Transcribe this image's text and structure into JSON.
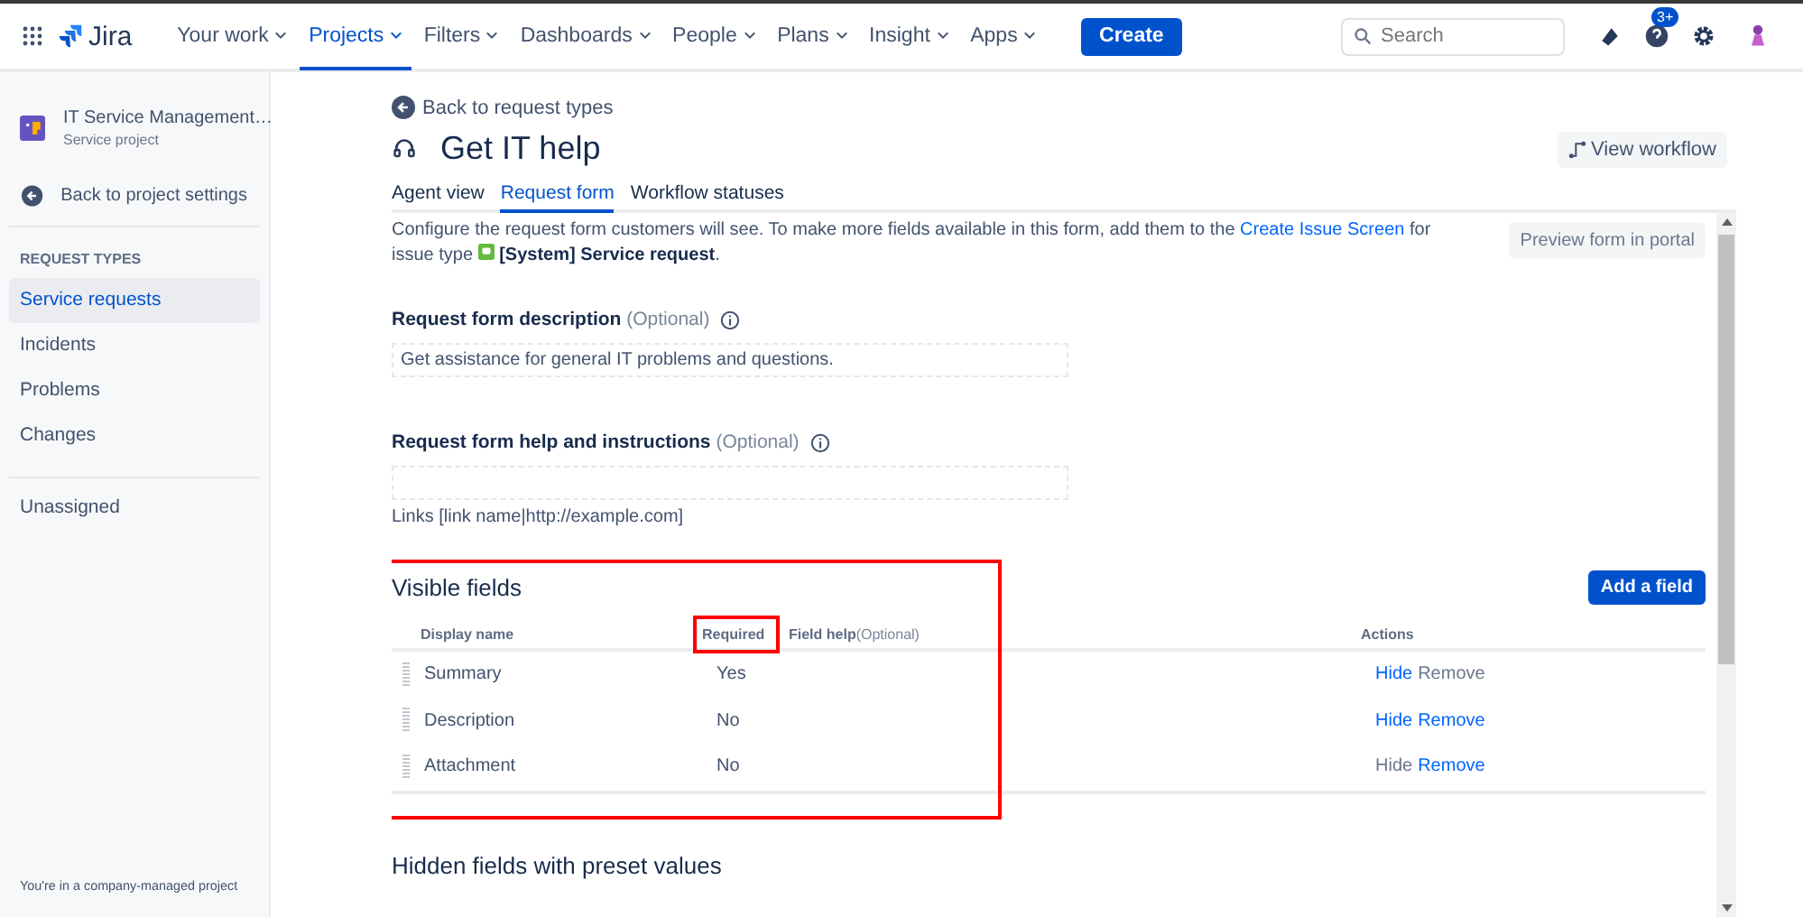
{
  "topnav": {
    "product": "Jira",
    "menus": [
      {
        "label": "Your work",
        "selected": false
      },
      {
        "label": "Projects",
        "selected": true
      },
      {
        "label": "Filters",
        "selected": false
      },
      {
        "label": "Dashboards",
        "selected": false
      },
      {
        "label": "People",
        "selected": false
      },
      {
        "label": "Plans",
        "selected": false
      },
      {
        "label": "Insight",
        "selected": false
      },
      {
        "label": "Apps",
        "selected": false
      }
    ],
    "create": "Create",
    "search": {
      "placeholder": "Search"
    },
    "help_badge": "3+"
  },
  "sidebar": {
    "project_name": "IT Service Management…",
    "project_type": "Service project",
    "back": "Back to project settings",
    "section": "REQUEST TYPES",
    "items": [
      {
        "label": "Service requests",
        "selected": true
      },
      {
        "label": "Incidents",
        "selected": false
      },
      {
        "label": "Problems",
        "selected": false
      },
      {
        "label": "Changes",
        "selected": false
      }
    ],
    "unassigned": "Unassigned",
    "footer": "You're in a company-managed project"
  },
  "header": {
    "back": "Back to request types",
    "title": "Get IT help",
    "view_workflow": "View workflow",
    "tabs": [
      {
        "label": "Agent view",
        "selected": false
      },
      {
        "label": "Request form",
        "selected": true
      },
      {
        "label": "Workflow statuses",
        "selected": false
      }
    ]
  },
  "form": {
    "intro_before": "Configure the request form customers will see. To make more fields available in this form, add them to the",
    "intro_link": "Create Issue Screen",
    "intro_mid": "for issue type",
    "intro_type": "[System] Service request",
    "intro_end": ".",
    "preview": "Preview form in portal",
    "description": {
      "label": "Request form description",
      "optional": "(Optional)",
      "value": "Get assistance for general IT problems and questions."
    },
    "help": {
      "label": "Request form help and instructions",
      "optional": "(Optional)",
      "hint": "Links [link name|http://example.com]"
    }
  },
  "visible_fields": {
    "title": "Visible fields",
    "highlighted": true,
    "add": "Add a field",
    "columns": [
      {
        "label": "Display name",
        "highlighted": false
      },
      {
        "label": "Required",
        "highlighted": true
      },
      {
        "label": "Field help",
        "optional": "(Optional)",
        "highlighted": false
      },
      {
        "label": "Actions",
        "highlighted": false
      }
    ],
    "rows": [
      {
        "name": "Summary",
        "required": "Yes",
        "actions": [
          {
            "label": "Hide",
            "disabled": false
          },
          {
            "label": "Remove",
            "disabled": true
          }
        ]
      },
      {
        "name": "Description",
        "required": "No",
        "actions": [
          {
            "label": "Hide",
            "disabled": false
          },
          {
            "label": "Remove",
            "disabled": false
          }
        ]
      },
      {
        "name": "Attachment",
        "required": "No",
        "actions": [
          {
            "label": "Hide",
            "disabled": true
          },
          {
            "label": "Remove",
            "disabled": false
          }
        ]
      }
    ]
  },
  "hidden_fields": {
    "title": "Hidden fields with preset values"
  }
}
